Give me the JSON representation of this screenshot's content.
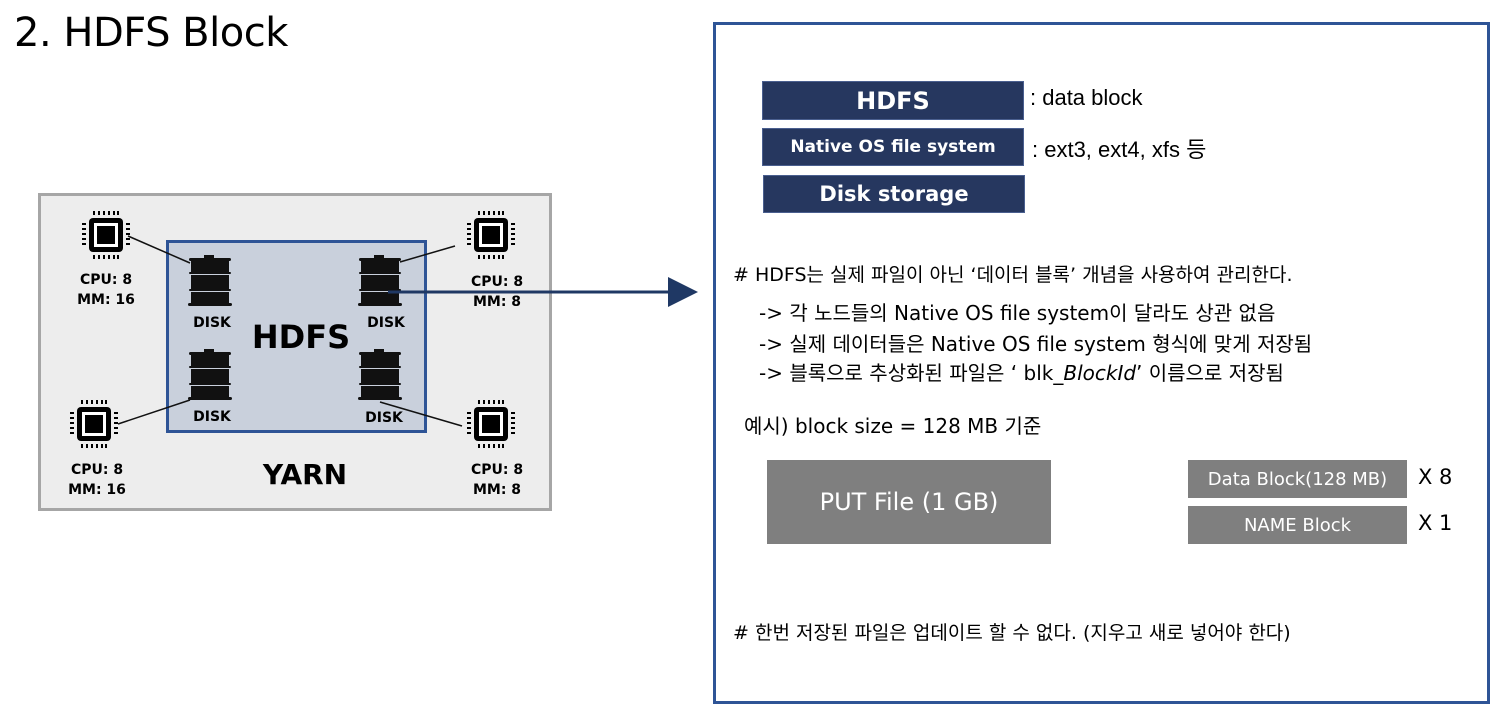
{
  "title": "2. HDFS Block",
  "diagram": {
    "outer_label": "YARN",
    "inner_label": "HDFS",
    "disk_label": "DISK",
    "nodes": [
      {
        "position": "top-left",
        "cpu": "CPU: 8",
        "mm": "MM: 16"
      },
      {
        "position": "top-right",
        "cpu": "CPU: 8",
        "mm": "MM: 8"
      },
      {
        "position": "bottom-left",
        "cpu": "CPU: 8",
        "mm": "MM: 16"
      },
      {
        "position": "bottom-right",
        "cpu": "CPU: 8",
        "mm": "MM: 8"
      }
    ],
    "colors": {
      "hdfs_border": "#2e5496",
      "hdfs_fill": "#c9d0dc",
      "yarn_fill": "#ededed",
      "yarn_border": "#a6a6a6",
      "arrow": "#1f3864"
    }
  },
  "panel": {
    "layers": [
      {
        "label": "HDFS",
        "desc": ": data block"
      },
      {
        "label": "Native OS file system",
        "desc": ": ext3, ext4, xfs 등"
      },
      {
        "label": "Disk storage",
        "desc": ""
      }
    ],
    "note1": "# HDFS는 실제 파일이 아닌 ‘데이터 블록’ 개념을 사용하여 관리한다.",
    "sub_points": [
      "-> 각 노드들의 Native OS file system이 달라도 상관 없음",
      "-> 실제 데이터들은 Native OS file system 형식에 맞게 저장됨",
      {
        "prefix": "-> 블록으로 추상화된 파일은 ‘ blk_",
        "italic": "BlockId",
        "suffix": "’ 이름으로 저장됨"
      }
    ],
    "example": "예시) block size = 128 MB 기준",
    "put_file": "PUT File (1 GB)",
    "blocks": [
      {
        "label": "Data Block(128 MB)",
        "multiplier": "X 8"
      },
      {
        "label": "NAME Block",
        "multiplier": "X 1"
      }
    ],
    "note2": "# 한번 저장된 파일은 업데이트 할 수 없다. (지우고 새로 넣어야 한다)",
    "colors": {
      "layer_box": "#26375f",
      "gray_box": "#7f7f7f",
      "panel_border": "#2e5496"
    }
  }
}
